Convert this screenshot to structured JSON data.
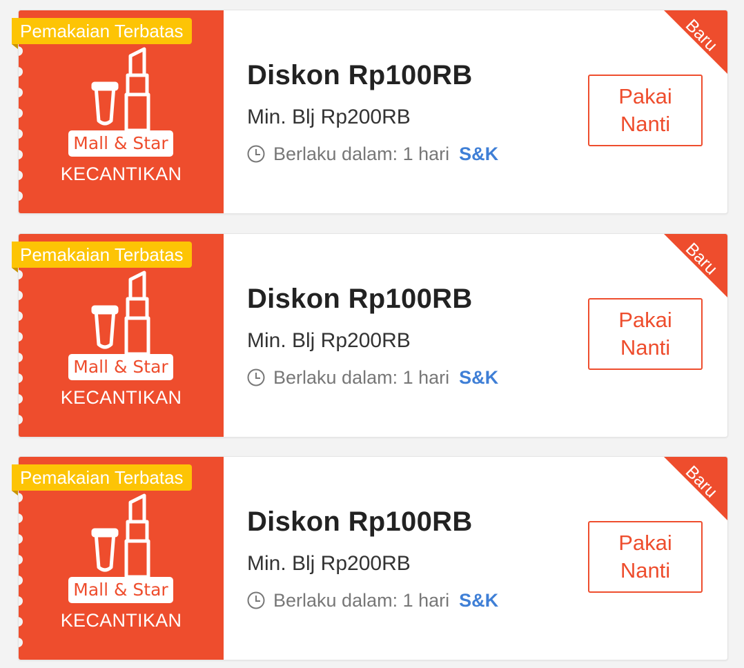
{
  "colors": {
    "brand": "#ee4d2d",
    "limited_tag": "#fdc405",
    "terms_link": "#3f7fd6"
  },
  "vouchers": [
    {
      "limited_tag": "Pemakaian Terbatas",
      "badge": "Mall & Star",
      "category": "KECANTIKAN",
      "icon": "lipstick-icon",
      "title": "Diskon Rp100RB",
      "min_spend": "Min. Blj Rp200RB",
      "validity": "Berlaku dalam: 1 hari",
      "terms": "S&K",
      "button_line1": "Pakai",
      "button_line2": "Nanti",
      "ribbon": "Baru"
    },
    {
      "limited_tag": "Pemakaian Terbatas",
      "badge": "Mall & Star",
      "category": "KECANTIKAN",
      "icon": "lipstick-icon",
      "title": "Diskon Rp100RB",
      "min_spend": "Min. Blj Rp200RB",
      "validity": "Berlaku dalam: 1 hari",
      "terms": "S&K",
      "button_line1": "Pakai",
      "button_line2": "Nanti",
      "ribbon": "Baru"
    },
    {
      "limited_tag": "Pemakaian Terbatas",
      "badge": "Mall & Star",
      "category": "KECANTIKAN",
      "icon": "lipstick-icon",
      "title": "Diskon Rp100RB",
      "min_spend": "Min. Blj Rp200RB",
      "validity": "Berlaku dalam: 1 hari",
      "terms": "S&K",
      "button_line1": "Pakai",
      "button_line2": "Nanti",
      "ribbon": "Baru"
    }
  ]
}
